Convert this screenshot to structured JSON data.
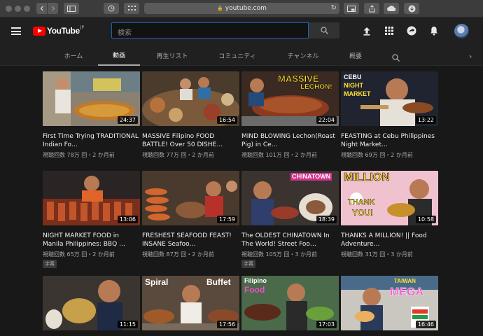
{
  "browser": {
    "url": "youtube.com",
    "lock_icon": "lock-icon"
  },
  "header": {
    "logo_text": "YouTube",
    "logo_region": "JP",
    "search_placeholder": "検索"
  },
  "tabs": [
    {
      "label": "ホーム",
      "active": false
    },
    {
      "label": "動画",
      "active": true
    },
    {
      "label": "再生リスト",
      "active": false
    },
    {
      "label": "コミュニティ",
      "active": false
    },
    {
      "label": "チャンネル",
      "active": false
    },
    {
      "label": "概要",
      "active": false
    }
  ],
  "videos": [
    {
      "title": "First Time Trying TRADITIONAL Indian Fo…",
      "meta": "視聴回数 78万 回・2 か月前",
      "duration": "24:37",
      "overlay": "",
      "badge": ""
    },
    {
      "title": "MASSIVE Filipino FOOD BATTLE! Over 50 DISHE…",
      "meta": "視聴回数 77万 回・2 か月前",
      "duration": "16:54",
      "overlay": "",
      "badge": ""
    },
    {
      "title": "MIND BLOWING Lechon(Roast Pig) in Ce…",
      "meta": "視聴回数 101万 回・2 か月前",
      "duration": "22:04",
      "overlay": "MASSIVE LECHON!",
      "badge": ""
    },
    {
      "title": "FEASTING at Cebu Philippines Night Market…",
      "meta": "視聴回数 69万 回・2 か月前",
      "duration": "13:22",
      "overlay": "CEBU NIGHT MARKET",
      "badge": ""
    },
    {
      "title": "NIGHT MARKET FOOD in Manila Philippines: BBQ …",
      "meta": "視聴回数 65万 回・2 か月前",
      "duration": "13:06",
      "overlay": "",
      "badge": "字幕"
    },
    {
      "title": "FRESHEST SEAFOOD FEAST! INSANE Seafoo…",
      "meta": "視聴回数 87万 回・2 か月前",
      "duration": "17:59",
      "overlay": "",
      "badge": ""
    },
    {
      "title": "The OLDEST CHINATOWN In The World! Street Foo…",
      "meta": "視聴回数 105万 回・3 か月前",
      "duration": "18:39",
      "overlay": "CHINATOWN",
      "badge": "字幕"
    },
    {
      "title": "THANKS A MILLION! || Food Adventure…",
      "meta": "視聴回数 31万 回・3 か月前",
      "duration": "10:58",
      "overlay": "MILLION THANK YOU!",
      "badge": ""
    },
    {
      "title": "",
      "meta": "",
      "duration": "11:15",
      "overlay": "",
      "badge": ""
    },
    {
      "title": "",
      "meta": "",
      "duration": "17:56",
      "overlay": "Spiral Buffet",
      "badge": ""
    },
    {
      "title": "",
      "meta": "",
      "duration": "17:03",
      "overlay": "Filipino Food",
      "badge": ""
    },
    {
      "title": "",
      "meta": "",
      "duration": "16:46",
      "overlay": "TAIWAN MEGA",
      "badge": ""
    }
  ],
  "colors": {
    "background": "#181818",
    "header": "#202020",
    "brand_red": "#ff0000",
    "search_focus": "#1c62b9"
  }
}
